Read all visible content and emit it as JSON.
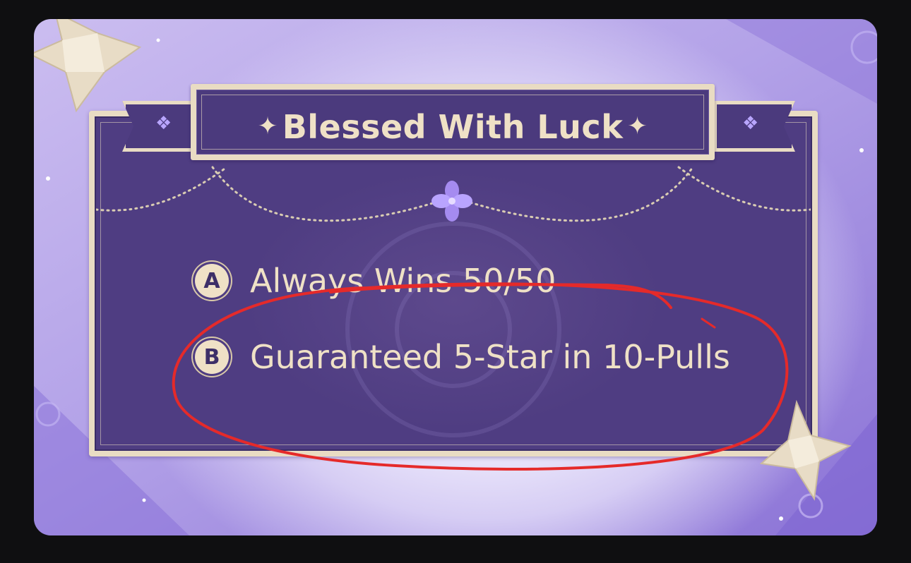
{
  "banner": {
    "title": "Blessed With Luck",
    "left_spark": "✦",
    "right_spark": "✦"
  },
  "options": [
    {
      "letter": "A",
      "text": "Always Wins 50/50",
      "struck_out": true
    },
    {
      "letter": "B",
      "text": "Guaranteed 5-Star in 10-Pulls",
      "circled": true
    }
  ],
  "colors": {
    "panel_purple": "#4f3d82",
    "cream": "#efe1c6",
    "annotation_red": "#e52a2a",
    "background_lilac": "#b3a2e8"
  },
  "icons": {
    "corner_star": "paper-star-icon",
    "ribbon_gem": "diamond-gem-icon",
    "center_flower": "four-petal-flower-icon"
  }
}
